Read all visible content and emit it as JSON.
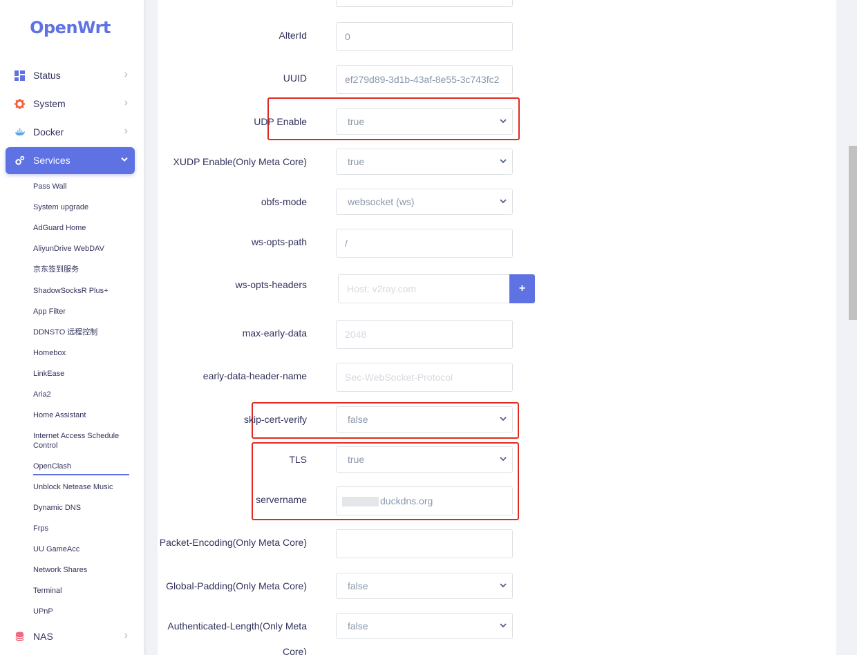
{
  "app": {
    "logo": "OpenWrt"
  },
  "colors": {
    "accent": "#5e72e4",
    "highlight_box": "#e02a20"
  },
  "sidebar": {
    "menus": [
      {
        "label": "Status",
        "icon": "dashboard-icon"
      },
      {
        "label": "System",
        "icon": "gear-icon"
      },
      {
        "label": "Docker",
        "icon": "docker-whale-icon"
      },
      {
        "label": "Services",
        "icon": "cogs-icon",
        "expanded": true
      },
      {
        "label": "NAS",
        "icon": "database-icon"
      }
    ],
    "services_items": [
      "Pass Wall",
      "System upgrade",
      "AdGuard Home",
      "AliyunDrive WebDAV",
      "京东签到服务",
      "ShadowSocksR Plus+",
      "App Filter",
      "DDNSTO 远程控制",
      "Homebox",
      "LinkEase",
      "Aria2",
      "Home Assistant",
      "Internet Access Schedule Control",
      "OpenClash",
      "Unblock Netease Music",
      "Dynamic DNS",
      "Frps",
      "UU GameAcc",
      "Network Shares",
      "Terminal",
      "UPnP"
    ],
    "current_item": "OpenClash"
  },
  "form": {
    "fields": [
      {
        "label": "AlterId",
        "value": "0",
        "type": "text"
      },
      {
        "label": "UUID",
        "value": "ef279d89-3d1b-43af-8e55-3c743fc2",
        "type": "text"
      },
      {
        "label": "UDP Enable",
        "value": "true",
        "type": "select"
      },
      {
        "label": "XUDP Enable(Only Meta Core)",
        "value": "true",
        "type": "select"
      },
      {
        "label": "obfs-mode",
        "value": "websocket (ws)",
        "type": "select"
      },
      {
        "label": "ws-opts-path",
        "value": "/",
        "type": "text"
      },
      {
        "label": "ws-opts-headers",
        "placeholder": "Host: v2ray.com",
        "type": "dynlist",
        "add_label": "+"
      },
      {
        "label": "max-early-data",
        "placeholder": "2048",
        "type": "text"
      },
      {
        "label": "early-data-header-name",
        "placeholder": "Sec-WebSocket-Protocol",
        "type": "text"
      },
      {
        "label": "skip-cert-verify",
        "value": "false",
        "type": "select"
      },
      {
        "label": "TLS",
        "value": "true",
        "type": "select"
      },
      {
        "label": "servername",
        "value": "duckdns.org",
        "type": "text"
      },
      {
        "label": "Packet-Encoding(Only Meta Core)",
        "value": "",
        "type": "text"
      },
      {
        "label": "Global-Padding(Only Meta Core)",
        "value": "false",
        "type": "select"
      },
      {
        "label": "Authenticated-Length(Only Meta",
        "label_line2": "Core)",
        "value": "false",
        "type": "select"
      }
    ]
  }
}
